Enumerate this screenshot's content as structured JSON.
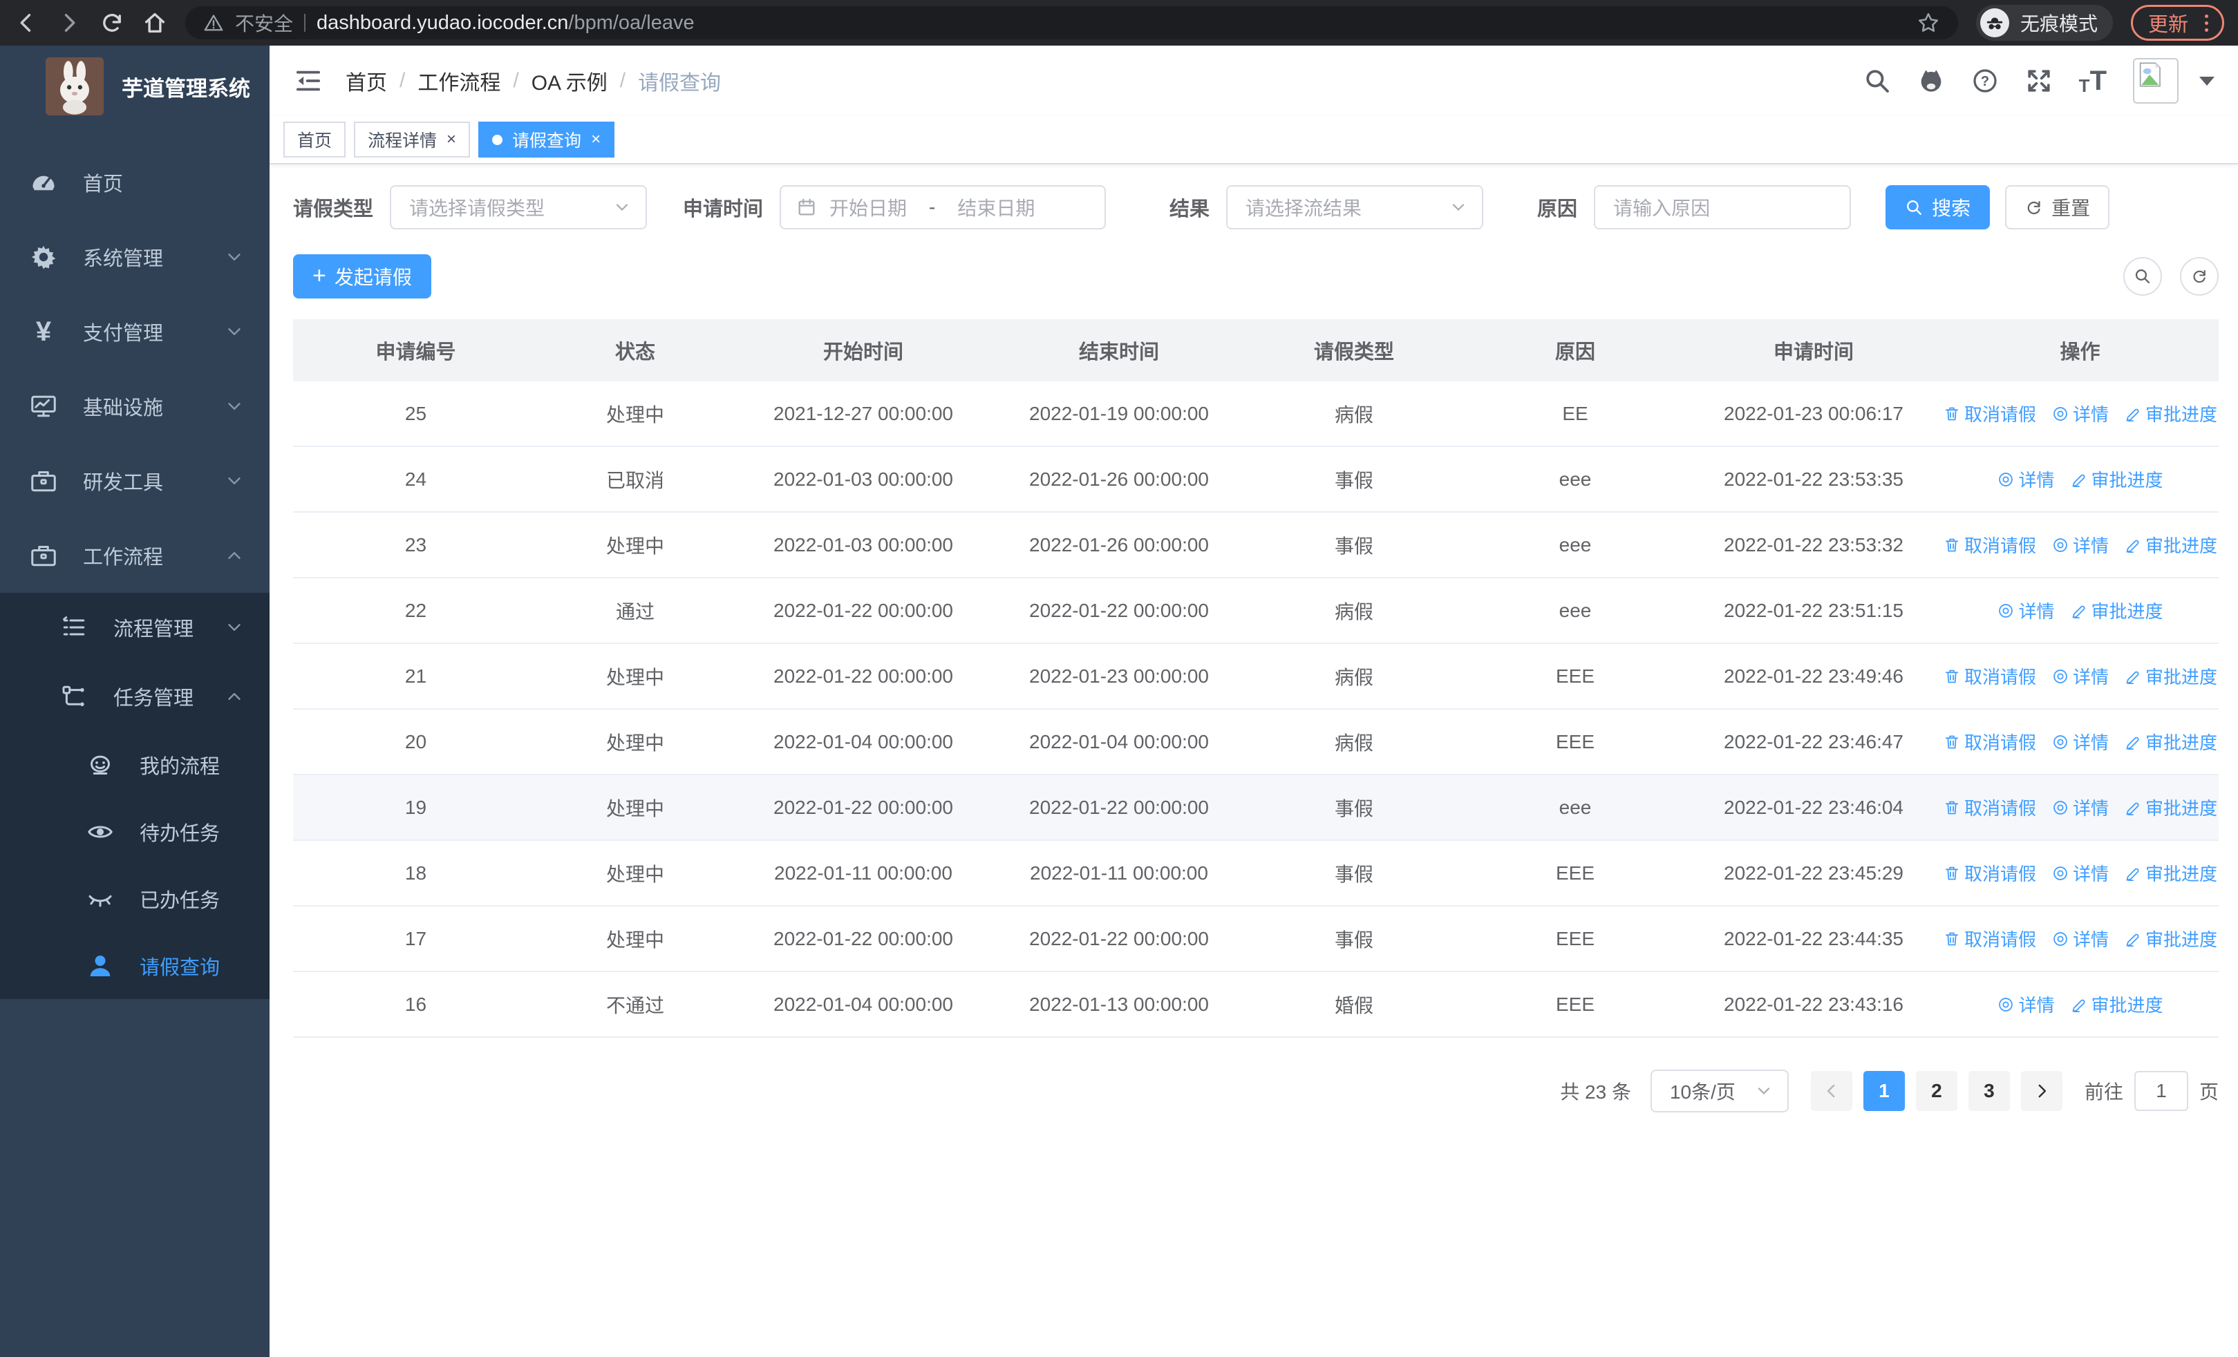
{
  "colors": {
    "primary": "#409eff",
    "sidebar_bg": "#304156",
    "submenu_bg": "#1f2d3d",
    "chrome_bg": "#26272b",
    "update_accent": "#ee8673",
    "table_border": "#ebeef5",
    "header_bg": "#f2f3f5"
  },
  "browser": {
    "security_label": "不安全",
    "url_host": "dashboard.yudao.iocoder.cn",
    "url_path": "/bpm/oa/leave",
    "incognito_label": "无痕模式",
    "update_label": "更新"
  },
  "icons": {
    "browser": [
      "back-arrow-icon",
      "forward-arrow-icon",
      "reload-icon",
      "home-icon",
      "warning-icon",
      "star-icon",
      "incognito-icon",
      "more-vert-icon"
    ],
    "navbar": [
      "fold-icon",
      "search-icon",
      "github-icon",
      "help-icon",
      "fullscreen-icon",
      "font-size-icon",
      "broken-image-icon",
      "caret-down-icon"
    ],
    "sidebar": [
      "dashboard-icon",
      "gear-icon",
      "yen-icon",
      "monitor-icon",
      "briefcase-icon",
      "briefcase-icon",
      "list-icon",
      "tree-icon",
      "robot-icon",
      "eye-icon",
      "eye-closed-icon",
      "user-icon"
    ]
  },
  "sidebar": {
    "title": "芋道管理系统",
    "home": {
      "label": "首页"
    },
    "system": {
      "label": "系统管理"
    },
    "payment": {
      "label": "支付管理"
    },
    "infra": {
      "label": "基础设施"
    },
    "dev_tools": {
      "label": "研发工具"
    },
    "workflow": {
      "label": "工作流程"
    },
    "process_mgmt": {
      "label": "流程管理"
    },
    "task_mgmt": {
      "label": "任务管理"
    },
    "my_process": {
      "label": "我的流程"
    },
    "todo_tasks": {
      "label": "待办任务"
    },
    "done_tasks": {
      "label": "已办任务"
    },
    "leave_query": {
      "label": "请假查询"
    }
  },
  "header": {
    "breadcrumb": {
      "home": "首页",
      "workflow": "工作流程",
      "oa": "OA 示例",
      "current": "请假查询"
    },
    "breadcrumb_separator": "/"
  },
  "tabs": {
    "home": "首页",
    "process_detail": "流程详情",
    "leave_query": "请假查询",
    "close_symbol": "×"
  },
  "filters": {
    "leave_type_label": "请假类型",
    "leave_type_placeholder": "请选择请假类型",
    "apply_time_label": "申请时间",
    "start_placeholder": "开始日期",
    "range_separator": "-",
    "end_placeholder": "结束日期",
    "result_label": "结果",
    "result_placeholder": "请选择流结果",
    "reason_label": "原因",
    "reason_placeholder": "请输入原因",
    "search_label": "搜索",
    "reset_label": "重置"
  },
  "toolbar": {
    "create_label": "发起请假"
  },
  "table": {
    "columns": {
      "id": "申请编号",
      "status": "状态",
      "start": "开始时间",
      "end": "结束时间",
      "type": "请假类型",
      "reason": "原因",
      "apply": "申请时间",
      "actions": "操作"
    },
    "rows": [
      {
        "id": "25",
        "status": "处理中",
        "start_time": "2021-12-27 00:00:00",
        "end_time": "2022-01-19 00:00:00",
        "leave_type": "病假",
        "reason": "EE",
        "apply_time": "2022-01-23 00:06:17",
        "highlighted": false,
        "actions": [
          {
            "name": "cancel-leave-link",
            "icon": "delete-icon",
            "label": "取消请假"
          },
          {
            "name": "detail-link",
            "icon": "view-icon",
            "label": "详情"
          },
          {
            "name": "progress-link",
            "icon": "edit-icon",
            "label": "审批进度"
          }
        ]
      },
      {
        "id": "24",
        "status": "已取消",
        "start_time": "2022-01-03 00:00:00",
        "end_time": "2022-01-26 00:00:00",
        "leave_type": "事假",
        "reason": "eee",
        "apply_time": "2022-01-22 23:53:35",
        "highlighted": false,
        "actions": [
          {
            "name": "detail-link",
            "icon": "view-icon",
            "label": "详情"
          },
          {
            "name": "progress-link",
            "icon": "edit-icon",
            "label": "审批进度"
          }
        ]
      },
      {
        "id": "23",
        "status": "处理中",
        "start_time": "2022-01-03 00:00:00",
        "end_time": "2022-01-26 00:00:00",
        "leave_type": "事假",
        "reason": "eee",
        "apply_time": "2022-01-22 23:53:32",
        "highlighted": false,
        "actions": [
          {
            "name": "cancel-leave-link",
            "icon": "delete-icon",
            "label": "取消请假"
          },
          {
            "name": "detail-link",
            "icon": "view-icon",
            "label": "详情"
          },
          {
            "name": "progress-link",
            "icon": "edit-icon",
            "label": "审批进度"
          }
        ]
      },
      {
        "id": "22",
        "status": "通过",
        "start_time": "2022-01-22 00:00:00",
        "end_time": "2022-01-22 00:00:00",
        "leave_type": "病假",
        "reason": "eee",
        "apply_time": "2022-01-22 23:51:15",
        "highlighted": false,
        "actions": [
          {
            "name": "detail-link",
            "icon": "view-icon",
            "label": "详情"
          },
          {
            "name": "progress-link",
            "icon": "edit-icon",
            "label": "审批进度"
          }
        ]
      },
      {
        "id": "21",
        "status": "处理中",
        "start_time": "2022-01-22 00:00:00",
        "end_time": "2022-01-23 00:00:00",
        "leave_type": "病假",
        "reason": "EEE",
        "apply_time": "2022-01-22 23:49:46",
        "highlighted": false,
        "actions": [
          {
            "name": "cancel-leave-link",
            "icon": "delete-icon",
            "label": "取消请假"
          },
          {
            "name": "detail-link",
            "icon": "view-icon",
            "label": "详情"
          },
          {
            "name": "progress-link",
            "icon": "edit-icon",
            "label": "审批进度"
          }
        ]
      },
      {
        "id": "20",
        "status": "处理中",
        "start_time": "2022-01-04 00:00:00",
        "end_time": "2022-01-04 00:00:00",
        "leave_type": "病假",
        "reason": "EEE",
        "apply_time": "2022-01-22 23:46:47",
        "highlighted": false,
        "actions": [
          {
            "name": "cancel-leave-link",
            "icon": "delete-icon",
            "label": "取消请假"
          },
          {
            "name": "detail-link",
            "icon": "view-icon",
            "label": "详情"
          },
          {
            "name": "progress-link",
            "icon": "edit-icon",
            "label": "审批进度"
          }
        ]
      },
      {
        "id": "19",
        "status": "处理中",
        "start_time": "2022-01-22 00:00:00",
        "end_time": "2022-01-22 00:00:00",
        "leave_type": "事假",
        "reason": "eee",
        "apply_time": "2022-01-22 23:46:04",
        "highlighted": true,
        "actions": [
          {
            "name": "cancel-leave-link",
            "icon": "delete-icon",
            "label": "取消请假"
          },
          {
            "name": "detail-link",
            "icon": "view-icon",
            "label": "详情"
          },
          {
            "name": "progress-link",
            "icon": "edit-icon",
            "label": "审批进度"
          }
        ]
      },
      {
        "id": "18",
        "status": "处理中",
        "start_time": "2022-01-11 00:00:00",
        "end_time": "2022-01-11 00:00:00",
        "leave_type": "事假",
        "reason": "EEE",
        "apply_time": "2022-01-22 23:45:29",
        "highlighted": false,
        "actions": [
          {
            "name": "cancel-leave-link",
            "icon": "delete-icon",
            "label": "取消请假"
          },
          {
            "name": "detail-link",
            "icon": "view-icon",
            "label": "详情"
          },
          {
            "name": "progress-link",
            "icon": "edit-icon",
            "label": "审批进度"
          }
        ]
      },
      {
        "id": "17",
        "status": "处理中",
        "start_time": "2022-01-22 00:00:00",
        "end_time": "2022-01-22 00:00:00",
        "leave_type": "事假",
        "reason": "EEE",
        "apply_time": "2022-01-22 23:44:35",
        "highlighted": false,
        "actions": [
          {
            "name": "cancel-leave-link",
            "icon": "delete-icon",
            "label": "取消请假"
          },
          {
            "name": "detail-link",
            "icon": "view-icon",
            "label": "详情"
          },
          {
            "name": "progress-link",
            "icon": "edit-icon",
            "label": "审批进度"
          }
        ]
      },
      {
        "id": "16",
        "status": "不通过",
        "start_time": "2022-01-04 00:00:00",
        "end_time": "2022-01-13 00:00:00",
        "leave_type": "婚假",
        "reason": "EEE",
        "apply_time": "2022-01-22 23:43:16",
        "highlighted": false,
        "actions": [
          {
            "name": "detail-link",
            "icon": "view-icon",
            "label": "详情"
          },
          {
            "name": "progress-link",
            "icon": "edit-icon",
            "label": "审批进度"
          }
        ]
      }
    ]
  },
  "pagination": {
    "total_label": "共 23 条",
    "page_size_label": "10条/页",
    "pages": [
      1,
      2,
      3
    ],
    "current_page": 1,
    "goto_label": "前往",
    "goto_value": "1",
    "goto_unit": "页"
  }
}
